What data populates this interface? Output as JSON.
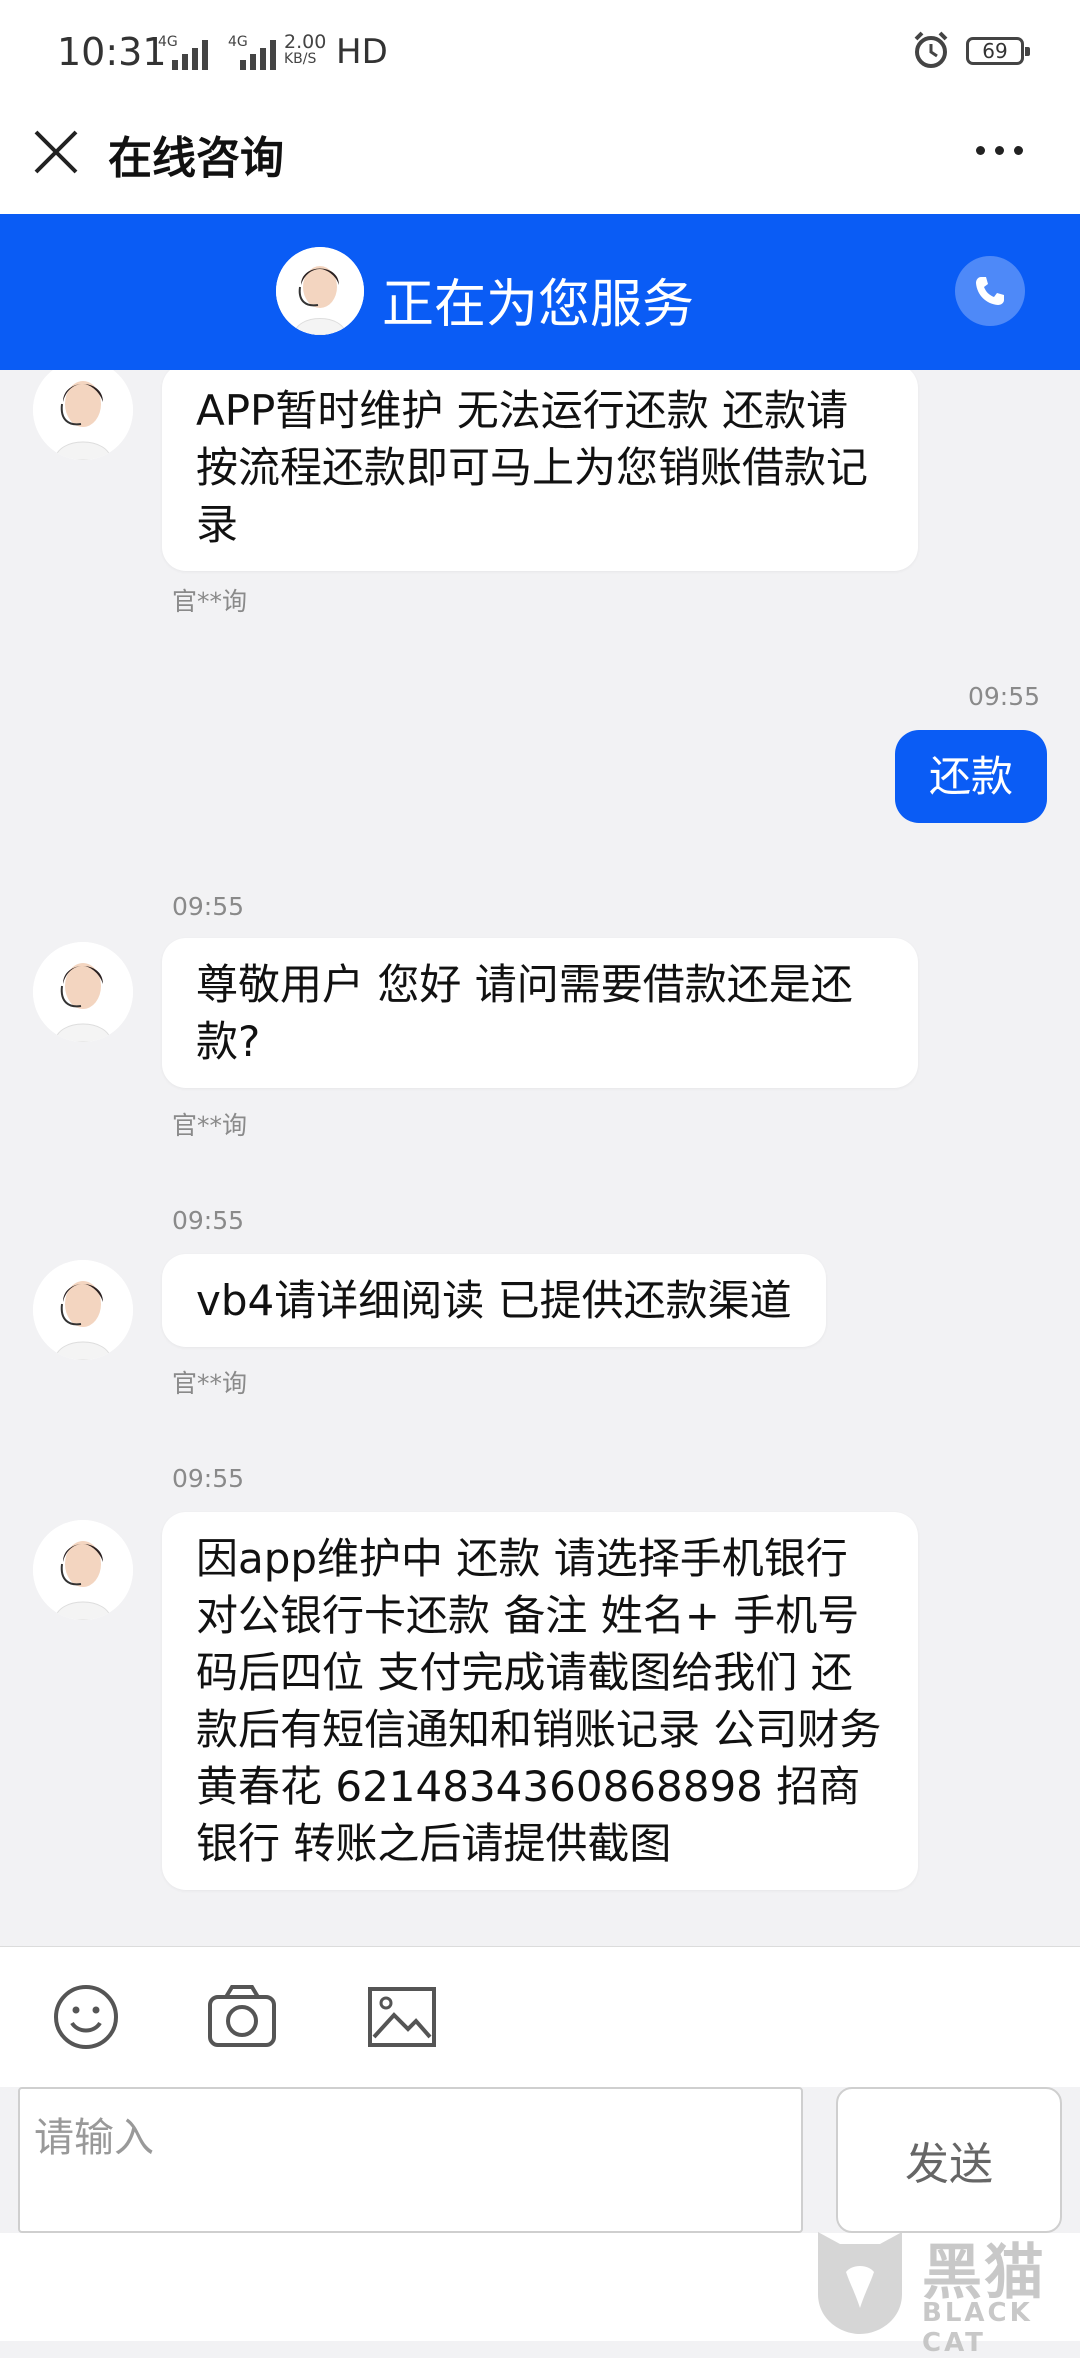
{
  "status_bar": {
    "time": "10:31",
    "net1": "4G",
    "net2": "4G",
    "speed_value": "2.00",
    "speed_unit": "KB/S",
    "hd": "HD",
    "battery": "69",
    "alarm_icon": "alarm-clock-icon"
  },
  "title_bar": {
    "title": "在线咨询",
    "close_icon": "close-icon",
    "more_icon": "more-dots-icon"
  },
  "banner": {
    "text": "正在为您服务",
    "phone_icon": "phone-icon",
    "color": "#0a5cf5"
  },
  "messages": [
    {
      "side": "in",
      "time": "",
      "text": "APP暂时维护 无法运行还款 还款请按流程还款即可马上为您销账借款记录",
      "sender": "官**询"
    },
    {
      "side": "out",
      "time": "09:55",
      "text": "还款"
    },
    {
      "side": "in",
      "time": "09:55",
      "text": "尊敬用户  您好  请问需要借款还是还款?",
      "sender": "官**询"
    },
    {
      "side": "in",
      "time": "09:55",
      "text": "vb4请详细阅读 已提供还款渠道",
      "sender": "官**询"
    },
    {
      "side": "in",
      "time": "09:55",
      "text": "因app维护中 还款 请选择手机银行  对公银行卡还款 备注 姓名+ 手机号码后四位 支付完成请截图给我们 还款后有短信通知和销账记录 公司财务 黄春花 6214834360868898 招商银行 转账之后请提供截图"
    }
  ],
  "input": {
    "placeholder": "请输入",
    "send_label": "发送",
    "emoji_icon": "emoji-icon",
    "camera_icon": "camera-icon",
    "image_icon": "image-icon"
  },
  "watermark": {
    "text1": "黑猫",
    "text2": "BLACK CAT"
  }
}
